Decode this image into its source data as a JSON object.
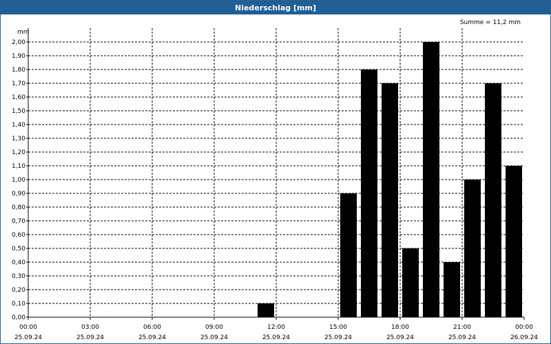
{
  "window": {
    "title": "Niederschlag [mm]"
  },
  "chart_data": {
    "type": "bar",
    "title": "Niederschlag [mm]",
    "ylabel": "mm",
    "annotation": "Summe = 11,2 mm",
    "ylim": [
      0,
      2.1
    ],
    "y_ticks": [
      "0,00",
      "0,10",
      "0,20",
      "0,30",
      "0,40",
      "0,50",
      "0,60",
      "0,70",
      "0,80",
      "0,90",
      "1,00",
      "1,10",
      "1,20",
      "1,30",
      "1,40",
      "1,50",
      "1,60",
      "1,70",
      "1,80",
      "1,90",
      "2,00"
    ],
    "x_ticks": [
      {
        "time": "00:00",
        "date": "25.09.24"
      },
      {
        "time": "03:00",
        "date": "25.09.24"
      },
      {
        "time": "06:00",
        "date": "25.09.24"
      },
      {
        "time": "09:00",
        "date": "25.09.24"
      },
      {
        "time": "12:00",
        "date": "25.09.24"
      },
      {
        "time": "15:00",
        "date": "25.09.24"
      },
      {
        "time": "18:00",
        "date": "25.09.24"
      },
      {
        "time": "21:00",
        "date": "25.09.24"
      },
      {
        "time": "00:00",
        "date": "26.09.24"
      }
    ],
    "x_range": [
      "25.09.24 00:00",
      "26.09.24 00:00"
    ],
    "grid": true,
    "bar_color": "#000000",
    "bars": [
      {
        "start": "25.09.24 11:00",
        "end": "25.09.24 12:00",
        "value": 0.1
      },
      {
        "start": "25.09.24 15:00",
        "end": "25.09.24 16:00",
        "value": 0.9
      },
      {
        "start": "25.09.24 16:00",
        "end": "25.09.24 17:00",
        "value": 1.8
      },
      {
        "start": "25.09.24 17:00",
        "end": "25.09.24 18:00",
        "value": 1.7
      },
      {
        "start": "25.09.24 18:00",
        "end": "25.09.24 19:00",
        "value": 0.5
      },
      {
        "start": "25.09.24 19:00",
        "end": "25.09.24 20:00",
        "value": 2.0
      },
      {
        "start": "25.09.24 20:00",
        "end": "25.09.24 21:00",
        "value": 0.4
      },
      {
        "start": "25.09.24 21:00",
        "end": "25.09.24 22:00",
        "value": 1.0
      },
      {
        "start": "25.09.24 22:00",
        "end": "25.09.24 23:00",
        "value": 1.7
      },
      {
        "start": "25.09.24 23:00",
        "end": "26.09.24 00:00",
        "value": 1.1
      }
    ]
  }
}
